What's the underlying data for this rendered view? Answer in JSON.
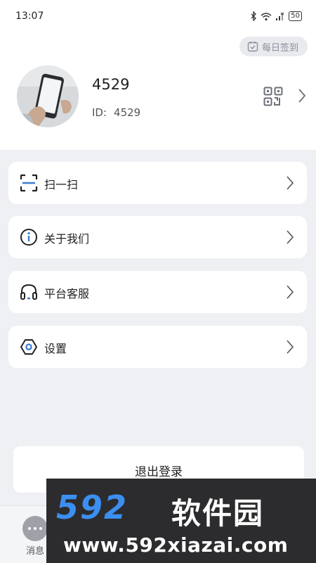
{
  "status_bar": {
    "time": "13:07",
    "battery": "50",
    "icons": [
      "bluetooth-icon",
      "wifi-icon",
      "signal-icon",
      "battery-icon"
    ]
  },
  "header": {
    "checkin_label": "每日签到",
    "username": "4529",
    "id_label": "ID:",
    "id_value": "4529"
  },
  "menu": {
    "items": [
      {
        "label": "扫一扫",
        "icon": "scan-icon"
      },
      {
        "label": "关于我们",
        "icon": "info-icon"
      },
      {
        "label": "平台客服",
        "icon": "headset-icon"
      },
      {
        "label": "设置",
        "icon": "settings-icon"
      }
    ]
  },
  "logout_label": "退出登录",
  "tabbar": {
    "message_label": "消息"
  },
  "watermark": {
    "logo_digits": "592",
    "logo_cn": "软件园",
    "url": "www.592xiazai.com"
  },
  "colors": {
    "accent": "#3a7bd5",
    "background": "#eef0f3",
    "card": "#ffffff",
    "watermark_blue": "#3b8ff0"
  }
}
